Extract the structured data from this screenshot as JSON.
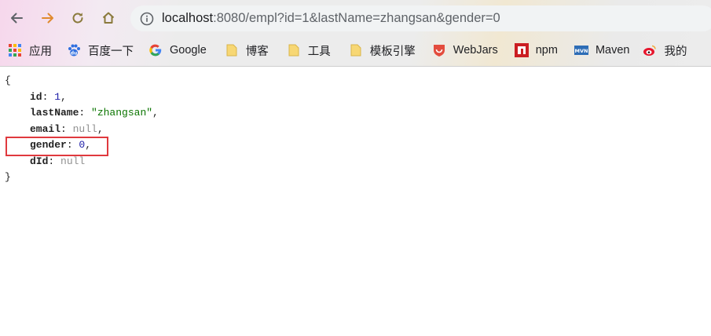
{
  "browser": {
    "url_host": "localhost",
    "url_rest": ":8080/empl?id=1&lastName=zhangsan&gender=0",
    "bookmarks": [
      {
        "label": "应用",
        "icon": "apps-grid-icon"
      },
      {
        "label": "百度一下",
        "icon": "baidu-paw-icon"
      },
      {
        "label": "Google",
        "icon": "google-g-icon"
      },
      {
        "label": "博客",
        "icon": "folder-icon"
      },
      {
        "label": "工具",
        "icon": "folder-icon"
      },
      {
        "label": "模板引擎",
        "icon": "folder-icon"
      },
      {
        "label": "WebJars",
        "icon": "webjars-icon"
      },
      {
        "label": "npm",
        "icon": "npm-icon"
      },
      {
        "label": "Maven",
        "icon": "maven-icon"
      },
      {
        "label": "我的",
        "icon": "weibo-icon"
      }
    ]
  },
  "json_view": {
    "open_brace": "{",
    "close_brace": "}",
    "fields": [
      {
        "key": "id",
        "value": "1",
        "type": "num",
        "comma": true
      },
      {
        "key": "lastName",
        "value": "\"zhangsan\"",
        "type": "str",
        "comma": true
      },
      {
        "key": "email",
        "value": "null",
        "type": "null",
        "comma": true
      },
      {
        "key": "gender",
        "value": "0",
        "type": "num",
        "comma": true
      },
      {
        "key": "dId",
        "value": "null",
        "type": "null",
        "comma": false
      }
    ]
  },
  "colors": {
    "highlight_border": "#e0393e",
    "json_number": "#1a1aa6",
    "json_string": "#0b7500",
    "json_null": "#909090"
  }
}
